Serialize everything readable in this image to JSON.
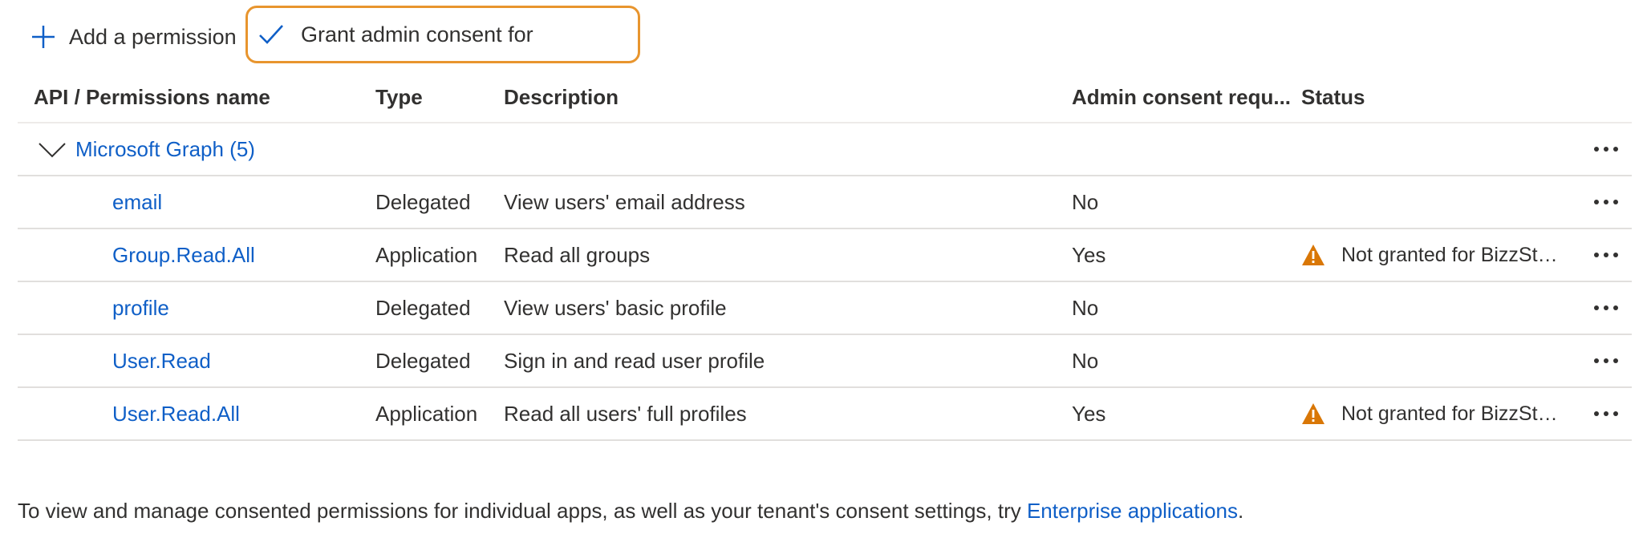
{
  "toolbar": {
    "add_permission_label": "Add a permission",
    "grant_consent_label": "Grant admin consent for"
  },
  "table": {
    "headers": {
      "name": "API / Permissions name",
      "type": "Type",
      "description": "Description",
      "admin_consent": "Admin consent requ...",
      "status": "Status"
    },
    "group": {
      "label": "Microsoft Graph (5)"
    },
    "rows": [
      {
        "name": "email",
        "type": "Delegated",
        "description": "View users' email address",
        "admin_consent": "No",
        "status": ""
      },
      {
        "name": "Group.Read.All",
        "type": "Application",
        "description": "Read all groups",
        "admin_consent": "Yes",
        "status": "Not granted for BizzStream"
      },
      {
        "name": "profile",
        "type": "Delegated",
        "description": "View users' basic profile",
        "admin_consent": "No",
        "status": ""
      },
      {
        "name": "User.Read",
        "type": "Delegated",
        "description": "Sign in and read user profile",
        "admin_consent": "No",
        "status": ""
      },
      {
        "name": "User.Read.All",
        "type": "Application",
        "description": "Read all users' full profiles",
        "admin_consent": "Yes",
        "status": "Not granted for BizzStream"
      }
    ]
  },
  "footer": {
    "text_before": "To view and manage consented permissions for individual apps, as well as your tenant's consent settings, try ",
    "link": "Enterprise applications",
    "text_after": "."
  },
  "colors": {
    "accent": "#0f5fc7",
    "highlight_border": "#e8952e",
    "warning": "#d97706"
  },
  "icons": {
    "add": "plus-icon",
    "grant": "checkmark-icon",
    "group_toggle": "chevron-down-icon",
    "more": "more-icon",
    "warning": "warning-icon"
  }
}
